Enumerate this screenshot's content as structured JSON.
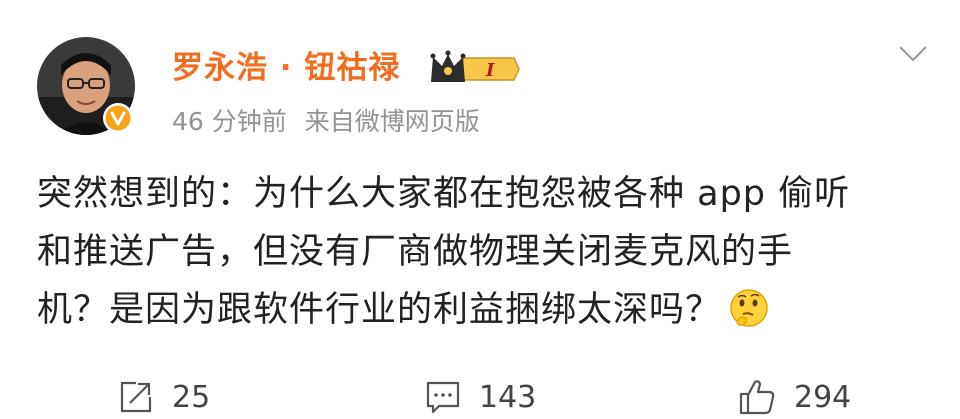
{
  "post": {
    "author": "罗永浩 · 钮祜禄",
    "vip_level": "I",
    "timestamp": "46 分钟前",
    "source": "来自微博网页版",
    "content_lines": [
      "突然想到的：为什么大家都在抱怨被各种 app 偷听",
      "和推送广告，但没有厂商做物理关闭麦克风的手",
      "机？是因为跟软件行业的利益捆绑太深吗？"
    ]
  },
  "actions": {
    "repost_count": "25",
    "comment_count": "143",
    "like_count": "294"
  },
  "colors": {
    "author": "#f36c21",
    "verified": "#f7a21b",
    "meta": "#939393",
    "text": "#222222",
    "icon": "#555555"
  },
  "icons": {
    "verified": "verified-v-badge-icon",
    "vip": "crown-vip-badge-icon",
    "menu": "chevron-down-icon",
    "emoji": "thinking-face-icon",
    "repost": "repost-share-icon",
    "comment": "comment-bubble-icon",
    "like": "thumbs-up-icon"
  }
}
